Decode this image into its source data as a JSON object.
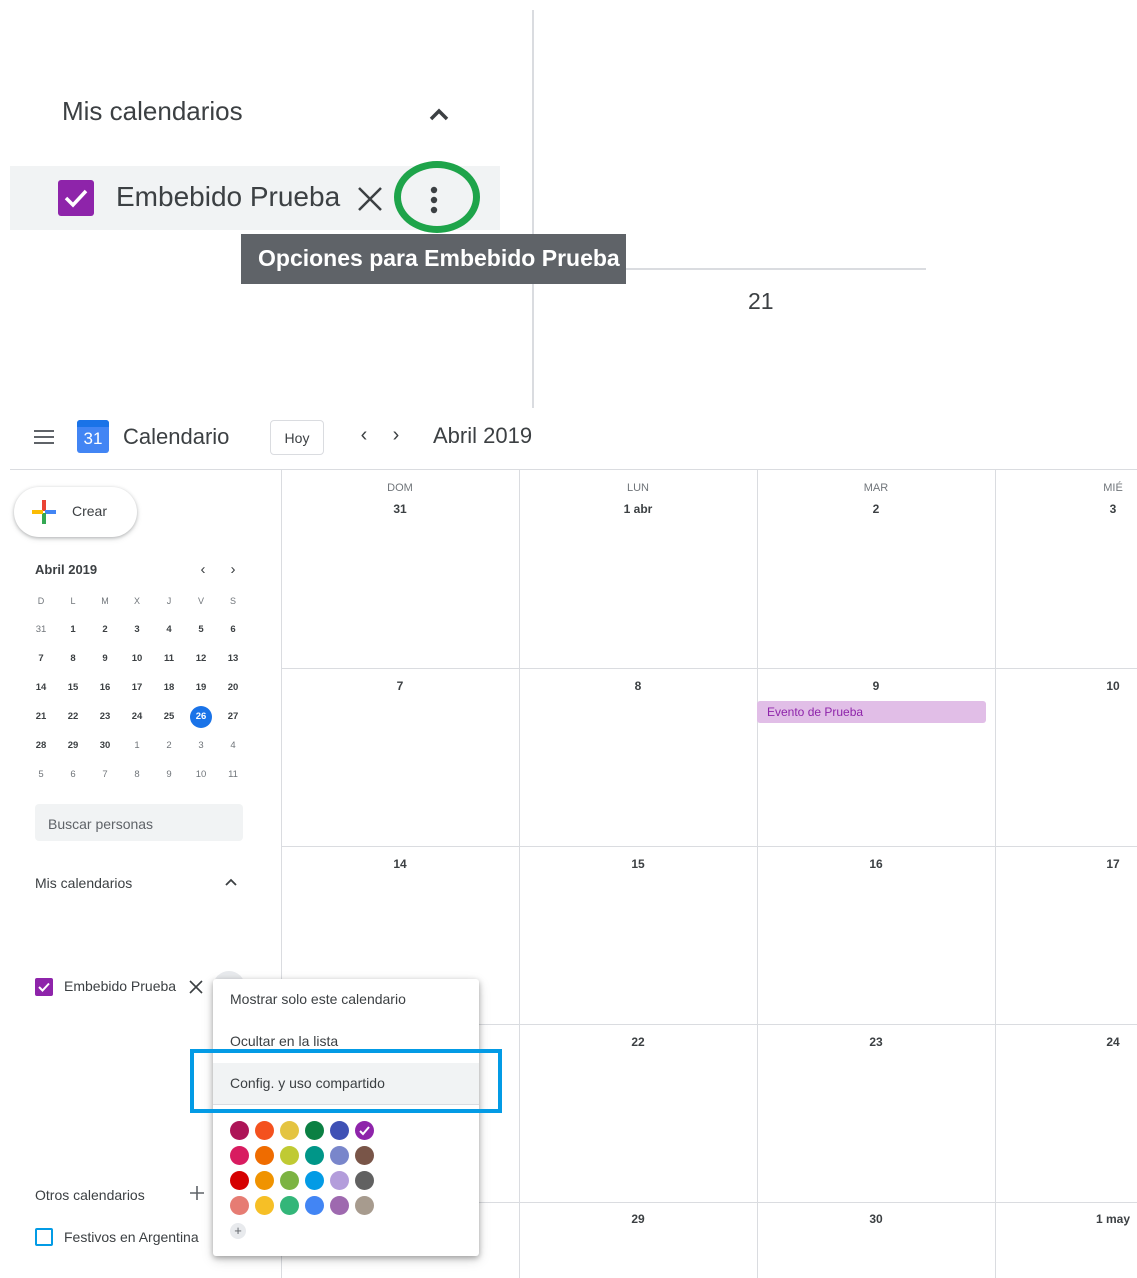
{
  "zoom": {
    "section_title": "Mis calendarios",
    "calendar_label": "Embebido Prueba",
    "tooltip": "Opciones para Embebido Prueba",
    "day_number": "21",
    "highlight_color": "#1ea44a"
  },
  "header": {
    "logo_day": "31",
    "app_name": "Calendario",
    "today_label": "Hoy",
    "prev_icon": "‹",
    "next_icon": "›",
    "month_title": "Abril 2019"
  },
  "sidebar": {
    "create_label": "Crear",
    "mini_calendar": {
      "month": "Abril 2019",
      "weekday_heads": [
        "D",
        "L",
        "M",
        "X",
        "J",
        "V",
        "S"
      ],
      "weeks": [
        [
          "31",
          "1",
          "2",
          "3",
          "4",
          "5",
          "6"
        ],
        [
          "7",
          "8",
          "9",
          "10",
          "11",
          "12",
          "13"
        ],
        [
          "14",
          "15",
          "16",
          "17",
          "18",
          "19",
          "20"
        ],
        [
          "21",
          "22",
          "23",
          "24",
          "25",
          "26",
          "27"
        ],
        [
          "28",
          "29",
          "30",
          "1",
          "2",
          "3",
          "4"
        ],
        [
          "5",
          "6",
          "7",
          "8",
          "9",
          "10",
          "11"
        ]
      ],
      "today": "26"
    },
    "search_placeholder": "Buscar personas",
    "my_calendars_title": "Mis calendarios",
    "calendar_label": "Embebido Prueba",
    "calendar_color": "#8e24aa",
    "other_calendars_title": "Otros calendarios",
    "holiday_label": "Festivos en Argentina",
    "holiday_color": "#039be5"
  },
  "grid": {
    "weekdays": [
      {
        "name": "DOM",
        "date": "31"
      },
      {
        "name": "LUN",
        "date": "1 abr"
      },
      {
        "name": "MAR",
        "date": "2"
      },
      {
        "name": "MIÉ",
        "date": "3"
      }
    ],
    "rows": [
      [
        "7",
        "8",
        "9",
        "10"
      ],
      [
        "14",
        "15",
        "16",
        "17"
      ],
      [
        "",
        "22",
        "23",
        "24"
      ],
      [
        "",
        "29",
        "30",
        "1 may"
      ]
    ],
    "event_label": "Evento de Prueba"
  },
  "menu": {
    "items": [
      "Mostrar solo este calendario",
      "Ocultar en la lista",
      "Config. y uso compartido"
    ],
    "highlight_color": "#039be5",
    "swatches": [
      [
        "#ad1457",
        "#f4511e",
        "#e4c441",
        "#0b8043",
        "#3f51b5",
        "#8e24aa"
      ],
      [
        "#d81b60",
        "#ef6c00",
        "#c0ca33",
        "#009688",
        "#7986cb",
        "#795548"
      ],
      [
        "#d50000",
        "#f09300",
        "#7cb342",
        "#039be5",
        "#b39ddb",
        "#616161"
      ],
      [
        "#e67c73",
        "#f6bf26",
        "#33b679",
        "#4285f4",
        "#9e69af",
        "#a79b8e"
      ]
    ],
    "selected_swatch": "#8e24aa",
    "add_color_icon": "+"
  }
}
